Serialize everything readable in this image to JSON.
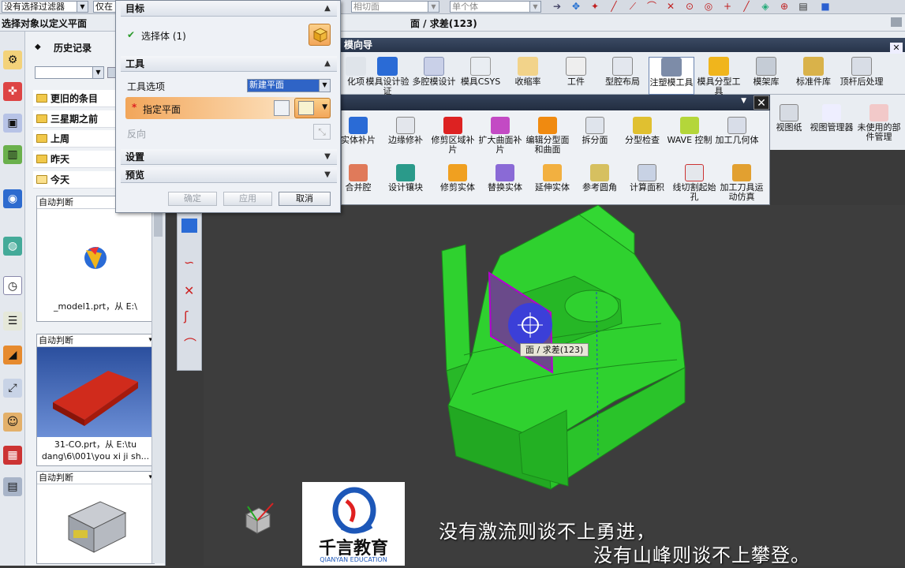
{
  "topbar": {
    "filter_combo": "没有选择过滤器",
    "scope_combo": "仅在",
    "face_combo": "相切面",
    "body_combo": "单个体"
  },
  "statusbar": {
    "prompt": "选择对象以定义平面",
    "selection_info": "面 / 求差(123)"
  },
  "history": {
    "title": "历史记录",
    "groups": [
      "更旧的条目",
      "三星期之前",
      "上周",
      "昨天",
      "今天"
    ],
    "thumbs": [
      {
        "mode": "自动判断",
        "caption": "_model1.prt，从 E:\\"
      },
      {
        "mode": "自动判断",
        "caption": "31-CO.prt，从 E:\\tu dang\\6\\001\\you xi ji sh..."
      },
      {
        "mode": "自动判断",
        "caption": ""
      }
    ]
  },
  "dialog": {
    "sec_target": "目标",
    "select_body": "选择体 (1)",
    "sec_tool": "工具",
    "tool_option_label": "工具选项",
    "tool_option_value": "新建平面",
    "specify_plane": "指定平面",
    "reverse": "反向",
    "sec_settings": "设置",
    "sec_preview": "预览",
    "ok": "确定",
    "apply": "应用",
    "cancel": "取消"
  },
  "ribbon": {
    "header": "模向导",
    "buttons": [
      "化项",
      "模具设计验证",
      "多腔模设计",
      "模具CSYS",
      "收缩率",
      "工件",
      "型腔布局",
      "注塑模工具",
      "模具分型工具",
      "模架库",
      "标准件库",
      "顶杆后处理"
    ]
  },
  "floatbar": {
    "row1": [
      "实体补片",
      "边缘修补",
      "修剪区域补片",
      "扩大曲面补片",
      "编辑分型面和曲面",
      "拆分面",
      "分型检查",
      "WAVE 控制",
      "加工几何体"
    ],
    "row2": [
      "合并腔",
      "设计镶块",
      "修剪实体",
      "替换实体",
      "延伸实体",
      "参考圆角",
      "计算面积",
      "线切割起始孔",
      "加工刀具运动仿真"
    ]
  },
  "rightpanel": {
    "items": [
      "视图纸",
      "视图管理器",
      "未使用的部件管理"
    ]
  },
  "viewport": {
    "tooltip": "面 / 求差(123)"
  },
  "subtitles": {
    "line1": "没有激流则谈不上勇进，",
    "line2": "没有山峰则谈不上攀登。"
  },
  "logo": {
    "name": "千言教育",
    "sub": "QIANYAN EDUCATION"
  },
  "colors": {
    "model_green": "#2fd12f",
    "selected_face": "#7a3aa0",
    "highlight_orange": "#f2a65a"
  }
}
